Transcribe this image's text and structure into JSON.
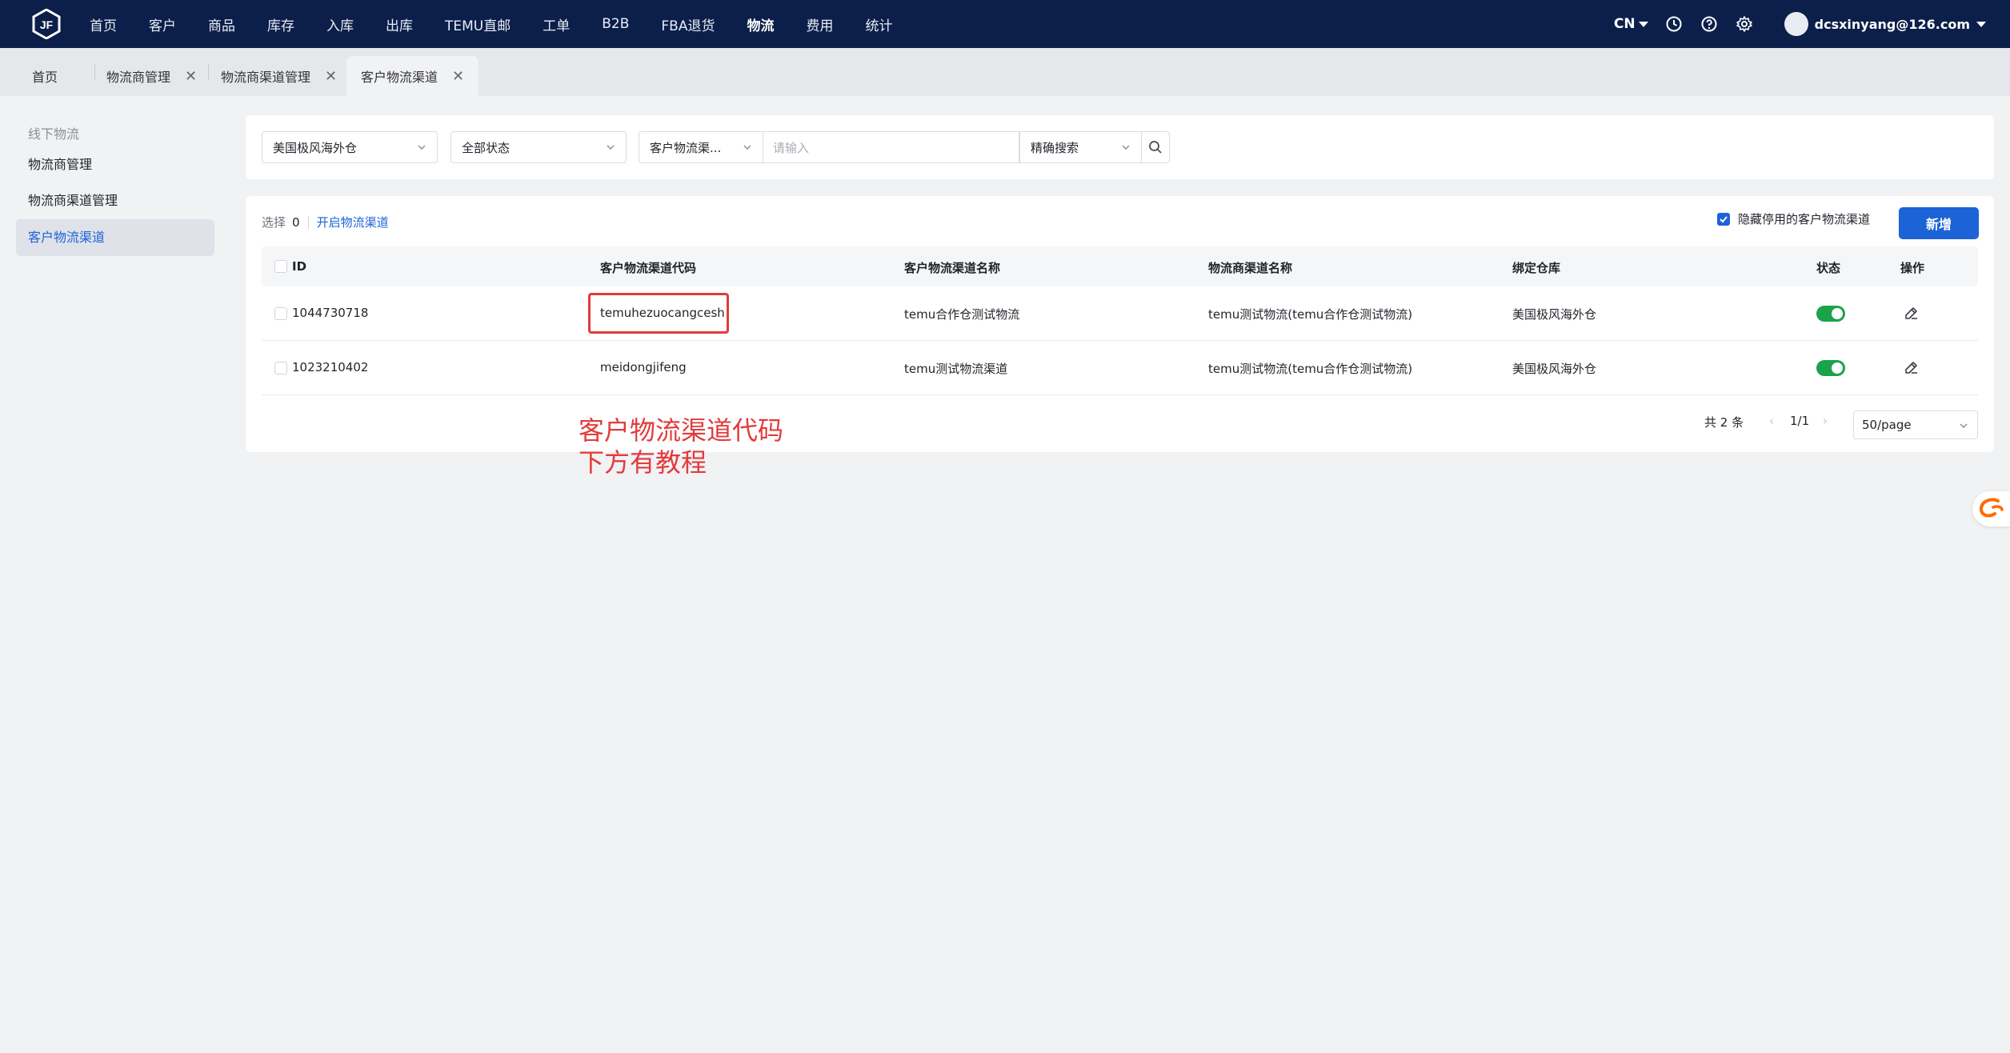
{
  "nav": {
    "items": [
      "首页",
      "客户",
      "商品",
      "库存",
      "入库",
      "出库",
      "TEMU直邮",
      "工单",
      "B2B",
      "FBA退货",
      "物流",
      "费用",
      "统计"
    ],
    "active_index": 10,
    "lang": "CN",
    "user_email": "dcsxinyang@126.com"
  },
  "tabs": {
    "home": "首页",
    "t1": "物流商管理",
    "t2": "物流商渠道管理",
    "t3": "客户物流渠道",
    "close": "✕"
  },
  "sidebar": {
    "group": "线下物流",
    "items": [
      "物流商管理",
      "物流商渠道管理",
      "客户物流渠道"
    ],
    "active_index": 2
  },
  "filters": {
    "warehouse": "美国极风海外仓",
    "status": "全部状态",
    "field": "客户物流渠...",
    "input_placeholder": "请输入",
    "mode": "精确搜索"
  },
  "toolbar": {
    "select_label": "选择",
    "select_count": "0",
    "enable_link": "开启物流渠道",
    "hide_disabled_label": "隐藏停用的客户物流渠道",
    "add_label": "新增"
  },
  "table": {
    "headers": {
      "id": "ID",
      "code": "客户物流渠道代码",
      "name": "客户物流渠道名称",
      "carrier": "物流商渠道名称",
      "warehouse": "绑定仓库",
      "status": "状态",
      "action": "操作"
    },
    "rows": [
      {
        "id": "1044730718",
        "code": "temuhezuocangcesh",
        "name": "temu合作仓测试物流",
        "carrier": "temu测试物流(temu合作仓测试物流)",
        "warehouse": "美国极风海外仓",
        "enabled": true
      },
      {
        "id": "1023210402",
        "code": "meidongjifeng",
        "name": "temu测试物流渠道",
        "carrier": "temu测试物流(temu合作仓测试物流)",
        "warehouse": "美国极风海外仓",
        "enabled": true
      }
    ]
  },
  "pagination": {
    "total": "共 2 条",
    "page": "1/1",
    "page_size": "50/page"
  },
  "annotation": {
    "line1": "客户物流渠道代码",
    "line2": "下方有教程"
  },
  "colors": {
    "nav_bg": "#0c1f4a",
    "primary": "#1d63d8",
    "toggle_on": "#1aa34a",
    "annotation": "#e23b3b"
  }
}
